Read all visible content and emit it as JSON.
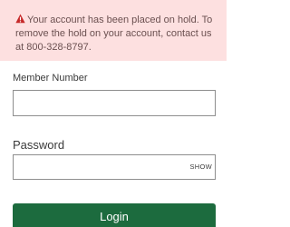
{
  "alert": {
    "message": "Your account has been placed on hold. To remove the hold on your account, contact us at 800-328-8797.",
    "icon": "warning-icon",
    "icon_color": "#c62828",
    "background": "#fde0e0"
  },
  "member_number": {
    "label": "Member Number",
    "value": "",
    "placeholder": ""
  },
  "password": {
    "label": "Password",
    "value": "",
    "placeholder": "",
    "show_label": "SHOW"
  },
  "login": {
    "label": "Login",
    "color": "#1c6b3e"
  }
}
